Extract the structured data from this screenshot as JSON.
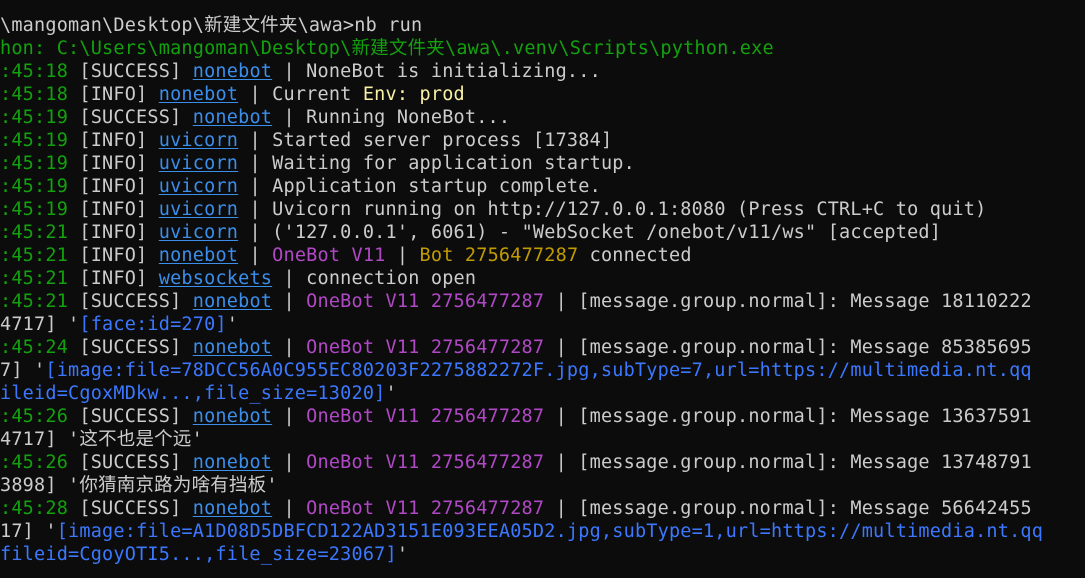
{
  "colors": {
    "background": "#0c0c0c",
    "default_text": "#cccccc",
    "green": "#13a10e",
    "module_blue": "#3b8eea",
    "cyan": "#4aa3f0",
    "yellow": "#f9f1a5",
    "magenta": "#b148c6",
    "gold": "#c19c00",
    "link_blue": "#3b78ff"
  },
  "terminal": {
    "lines": [
      {
        "segments": [
          {
            "text": "\\mangoman\\Desktop\\新建文件夹\\awa>nb run",
            "color": "default"
          }
        ]
      },
      {
        "segments": [
          {
            "text": "hon: C:\\Users\\mangoman\\Desktop\\新建文件夹\\awa\\.venv\\Scripts\\python.exe",
            "color": "green"
          }
        ]
      },
      {
        "segments": [
          {
            "text": ":45:18",
            "color": "green"
          },
          {
            "text": " [SUCCESS] ",
            "color": "default"
          },
          {
            "text": "nonebot",
            "color": "module",
            "underline": true
          },
          {
            "text": " | NoneBot is initializing...",
            "color": "default"
          }
        ]
      },
      {
        "segments": [
          {
            "text": ":45:18",
            "color": "green"
          },
          {
            "text": " [INFO] ",
            "color": "default"
          },
          {
            "text": "nonebot",
            "color": "module",
            "underline": true
          },
          {
            "text": " | Current ",
            "color": "default"
          },
          {
            "text": "Env: prod",
            "color": "yellow"
          }
        ]
      },
      {
        "segments": [
          {
            "text": ":45:19",
            "color": "green"
          },
          {
            "text": " [SUCCESS] ",
            "color": "default"
          },
          {
            "text": "nonebot",
            "color": "module",
            "underline": true
          },
          {
            "text": " | Running NoneBot...",
            "color": "default"
          }
        ]
      },
      {
        "segments": [
          {
            "text": ":45:19",
            "color": "green"
          },
          {
            "text": " [INFO] ",
            "color": "default"
          },
          {
            "text": "uvicorn",
            "color": "module",
            "underline": true
          },
          {
            "text": " | Started server process [17384]",
            "color": "default"
          }
        ]
      },
      {
        "segments": [
          {
            "text": ":45:19",
            "color": "green"
          },
          {
            "text": " [INFO] ",
            "color": "default"
          },
          {
            "text": "uvicorn",
            "color": "module",
            "underline": true
          },
          {
            "text": " | Waiting for application startup.",
            "color": "default"
          }
        ]
      },
      {
        "segments": [
          {
            "text": ":45:19",
            "color": "green"
          },
          {
            "text": " [INFO] ",
            "color": "default"
          },
          {
            "text": "uvicorn",
            "color": "module",
            "underline": true
          },
          {
            "text": " | Application startup complete.",
            "color": "default"
          }
        ]
      },
      {
        "segments": [
          {
            "text": ":45:19",
            "color": "green"
          },
          {
            "text": " [INFO] ",
            "color": "default"
          },
          {
            "text": "uvicorn",
            "color": "module",
            "underline": true
          },
          {
            "text": " | Uvicorn running on http://127.0.0.1:8080 (Press CTRL+C to quit)",
            "color": "default"
          }
        ]
      },
      {
        "segments": [
          {
            "text": ":45:21",
            "color": "green"
          },
          {
            "text": " [INFO] ",
            "color": "default"
          },
          {
            "text": "uvicorn",
            "color": "module",
            "underline": true
          },
          {
            "text": " | ('127.0.0.1', 6061) - \"WebSocket /onebot/v11/ws\" [accepted]",
            "color": "default"
          }
        ]
      },
      {
        "segments": [
          {
            "text": ":45:21",
            "color": "green"
          },
          {
            "text": " [INFO] ",
            "color": "default"
          },
          {
            "text": "nonebot",
            "color": "module",
            "underline": true
          },
          {
            "text": " | ",
            "color": "default"
          },
          {
            "text": "OneBot V11",
            "color": "magenta"
          },
          {
            "text": " | ",
            "color": "default"
          },
          {
            "text": "Bot 2756477287",
            "color": "gold"
          },
          {
            "text": " connected",
            "color": "default"
          }
        ]
      },
      {
        "segments": [
          {
            "text": ":45:21",
            "color": "green"
          },
          {
            "text": " [INFO] ",
            "color": "default"
          },
          {
            "text": "websockets",
            "color": "module",
            "underline": true
          },
          {
            "text": " | connection open",
            "color": "default"
          }
        ]
      },
      {
        "segments": [
          {
            "text": ":45:21",
            "color": "green"
          },
          {
            "text": " [SUCCESS] ",
            "color": "default"
          },
          {
            "text": "nonebot",
            "color": "module",
            "underline": true
          },
          {
            "text": " | ",
            "color": "default"
          },
          {
            "text": "OneBot V11 2756477287",
            "color": "magenta"
          },
          {
            "text": " | [message.group.normal]: Message 18110222",
            "color": "default"
          }
        ]
      },
      {
        "segments": [
          {
            "text": "4717] '",
            "color": "default"
          },
          {
            "text": "[face:id=270]",
            "color": "link"
          },
          {
            "text": "'",
            "color": "default"
          }
        ]
      },
      {
        "segments": [
          {
            "text": ":45:24",
            "color": "green"
          },
          {
            "text": " [SUCCESS] ",
            "color": "default"
          },
          {
            "text": "nonebot",
            "color": "module",
            "underline": true
          },
          {
            "text": " | ",
            "color": "default"
          },
          {
            "text": "OneBot V11 2756477287",
            "color": "magenta"
          },
          {
            "text": " | [message.group.normal]: Message 85385695",
            "color": "default"
          }
        ]
      },
      {
        "segments": [
          {
            "text": "7] '",
            "color": "default"
          },
          {
            "text": "[image:file=78DCC56A0C955EC80203F2275882272F.jpg,subType=7,url=https://multimedia.nt.qq",
            "color": "link"
          }
        ]
      },
      {
        "segments": [
          {
            "text": "ileid=CgoxMDkw...,file_size=13020]",
            "color": "link"
          },
          {
            "text": "'",
            "color": "default"
          }
        ]
      },
      {
        "segments": [
          {
            "text": ":45:26",
            "color": "green"
          },
          {
            "text": " [SUCCESS] ",
            "color": "default"
          },
          {
            "text": "nonebot",
            "color": "module",
            "underline": true
          },
          {
            "text": " | ",
            "color": "default"
          },
          {
            "text": "OneBot V11 2756477287",
            "color": "magenta"
          },
          {
            "text": " | [message.group.normal]: Message 13637591",
            "color": "default"
          }
        ]
      },
      {
        "segments": [
          {
            "text": "4717] '这不也是个远'",
            "color": "default"
          }
        ]
      },
      {
        "segments": [
          {
            "text": ":45:26",
            "color": "green"
          },
          {
            "text": " [SUCCESS] ",
            "color": "default"
          },
          {
            "text": "nonebot",
            "color": "module",
            "underline": true
          },
          {
            "text": " | ",
            "color": "default"
          },
          {
            "text": "OneBot V11 2756477287",
            "color": "magenta"
          },
          {
            "text": " | [message.group.normal]: Message 13748791",
            "color": "default"
          }
        ]
      },
      {
        "segments": [
          {
            "text": "3898] '你猜南京路为啥有挡板'",
            "color": "default"
          }
        ]
      },
      {
        "segments": [
          {
            "text": ":45:28",
            "color": "green"
          },
          {
            "text": " [SUCCESS] ",
            "color": "default"
          },
          {
            "text": "nonebot",
            "color": "module",
            "underline": true
          },
          {
            "text": " | ",
            "color": "default"
          },
          {
            "text": "OneBot V11 2756477287",
            "color": "magenta"
          },
          {
            "text": " | [message.group.normal]: Message 56642455",
            "color": "default"
          }
        ]
      },
      {
        "segments": [
          {
            "text": "17] '",
            "color": "default"
          },
          {
            "text": "[image:file=A1D08D5DBFCD122AD3151E093EEA05D2.jpg,subType=1,url=https://multimedia.nt.qq",
            "color": "link"
          }
        ]
      },
      {
        "segments": [
          {
            "text": "fileid=CgoyOTI5...,file_size=23067]",
            "color": "link"
          },
          {
            "text": "'",
            "color": "default"
          }
        ]
      }
    ]
  }
}
